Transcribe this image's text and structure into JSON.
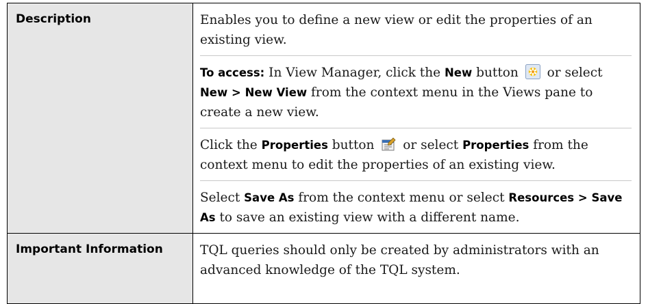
{
  "description_row": {
    "label": "Description",
    "para1": "Enables you to define a new view or edit the properties of an existing view.",
    "para2": {
      "to_access": "To access:",
      "t1": " In View Manager, click the ",
      "new_button": "New",
      "t2": " button ",
      "t3": " or select ",
      "new_menu": "New",
      "sep": " > ",
      "new_view": "New View",
      "t4": " from the context menu in the Views pane to create a new view."
    },
    "para3": {
      "t1": "Click the ",
      "properties_button": "Properties",
      "t2": " button ",
      "t3": " or select ",
      "properties_menu": "Properties",
      "t4": " from the context menu to edit the properties of an existing view."
    },
    "para4": {
      "t1": "Select ",
      "save_as": "Save As",
      "t2": " from the context menu or select ",
      "resources": "Resources",
      "sep": " > ",
      "save_as_2": "Save As",
      "t3": " to save an existing view with a different name."
    }
  },
  "important_row": {
    "label": "Important Information",
    "text": "TQL queries should only be created by administrators with an advanced knowledge of the TQL system."
  },
  "icons": {
    "new": "new-view-icon",
    "properties": "properties-icon"
  }
}
